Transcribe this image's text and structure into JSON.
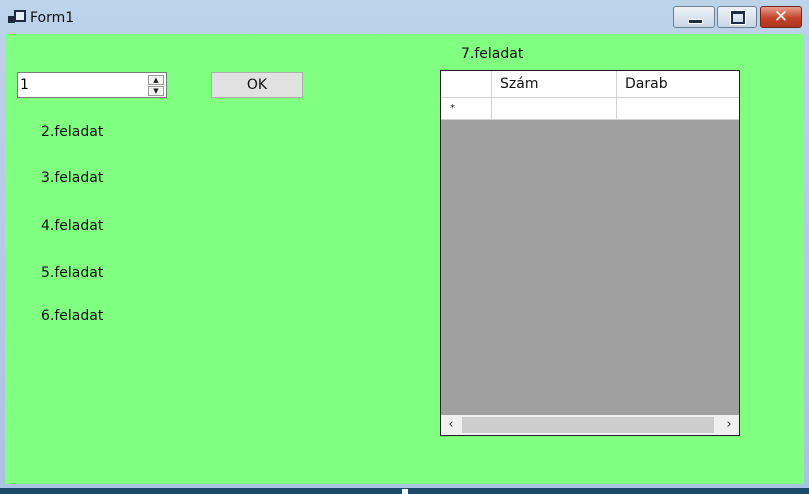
{
  "window": {
    "title": "Form1",
    "background": "#80ff80"
  },
  "numeric": {
    "value": "1"
  },
  "ok_button": {
    "label": "OK"
  },
  "labels": [
    "2.feladat",
    "3.feladat",
    "4.feladat",
    "5.feladat",
    "6.feladat"
  ],
  "grid": {
    "title": "7.feladat",
    "columns": [
      "Szám",
      "Darab"
    ],
    "new_row_glyph": "*"
  }
}
